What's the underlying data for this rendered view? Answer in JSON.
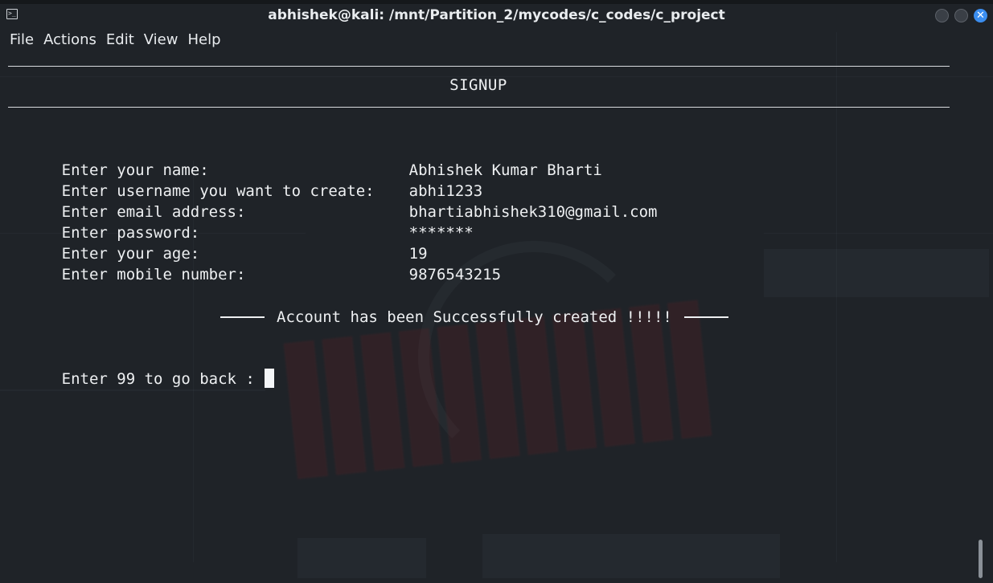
{
  "window": {
    "title": "abhishek@kali: /mnt/Partition_2/mycodes/c_codes/c_project",
    "close_glyph": "✕"
  },
  "menu": [
    "File",
    "Actions",
    "Edit",
    "View",
    "Help"
  ],
  "terminal": {
    "heading": "SIGNUP",
    "fields": [
      {
        "label": "Enter your name:",
        "value": "Abhishek Kumar Bharti"
      },
      {
        "label": "Enter username you want to create:",
        "value": "abhi1233"
      },
      {
        "label": "Enter email address:",
        "value": "bhartiabhishek310@gmail.com"
      },
      {
        "label": "Enter password:",
        "value": "*******"
      },
      {
        "label": "Enter your age:",
        "value": "19"
      },
      {
        "label": "Enter mobile number:",
        "value": "9876543215"
      }
    ],
    "success_message": "Account has been Successfully created !!!!!",
    "prompt": "Enter 99 to go back : "
  },
  "icons": {
    "terminal": "terminal-icon",
    "minimize": "minimize-icon",
    "maximize": "maximize-icon",
    "close": "close-icon"
  },
  "colors": {
    "background": "#1f2328",
    "text": "#eef0f2",
    "close_button": "#3b8ef0"
  }
}
